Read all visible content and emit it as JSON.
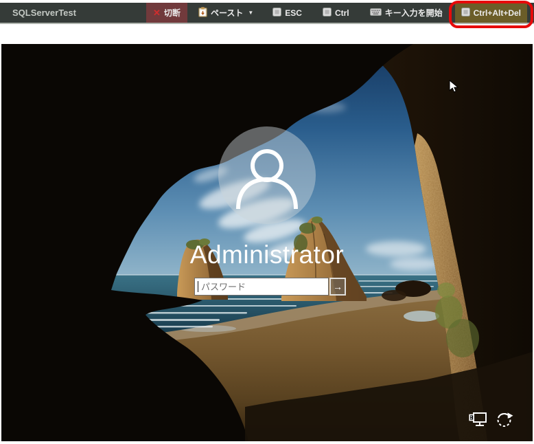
{
  "window": {
    "title": "SQLServerTest"
  },
  "toolbar": {
    "disconnect": {
      "glyph": "✕",
      "label": "切断"
    },
    "paste": {
      "label": "ペースト",
      "caret": "▼"
    },
    "esc": {
      "label": "ESC"
    },
    "ctrl": {
      "label": "Ctrl"
    },
    "key_input": {
      "label": "キー入力を開始"
    },
    "ctrl_alt_del": {
      "label": "Ctrl+Alt+Del"
    }
  },
  "login": {
    "username": "Administrator",
    "password": {
      "value": "",
      "placeholder": "パスワード"
    },
    "submit_glyph": "→"
  },
  "annotation": {
    "shape": "rounded-rectangle-highlight",
    "target": "ctrl-alt-del-button",
    "color": "#e60a0a"
  },
  "icons": {
    "toolbar": [
      "x-icon",
      "clipboard-paste-icon",
      "keycap-icon",
      "keyboard-icon"
    ],
    "lock_screen": [
      "user-avatar-icon",
      "network-icon",
      "power-icon",
      "mouse-cursor-icon"
    ]
  },
  "colors": {
    "toolbar_bg": "#353b38",
    "disconnect_bg": "#713a3c",
    "ctrl_alt_del_bg": "#6b5d28",
    "annotation_red": "#e60a0a"
  }
}
